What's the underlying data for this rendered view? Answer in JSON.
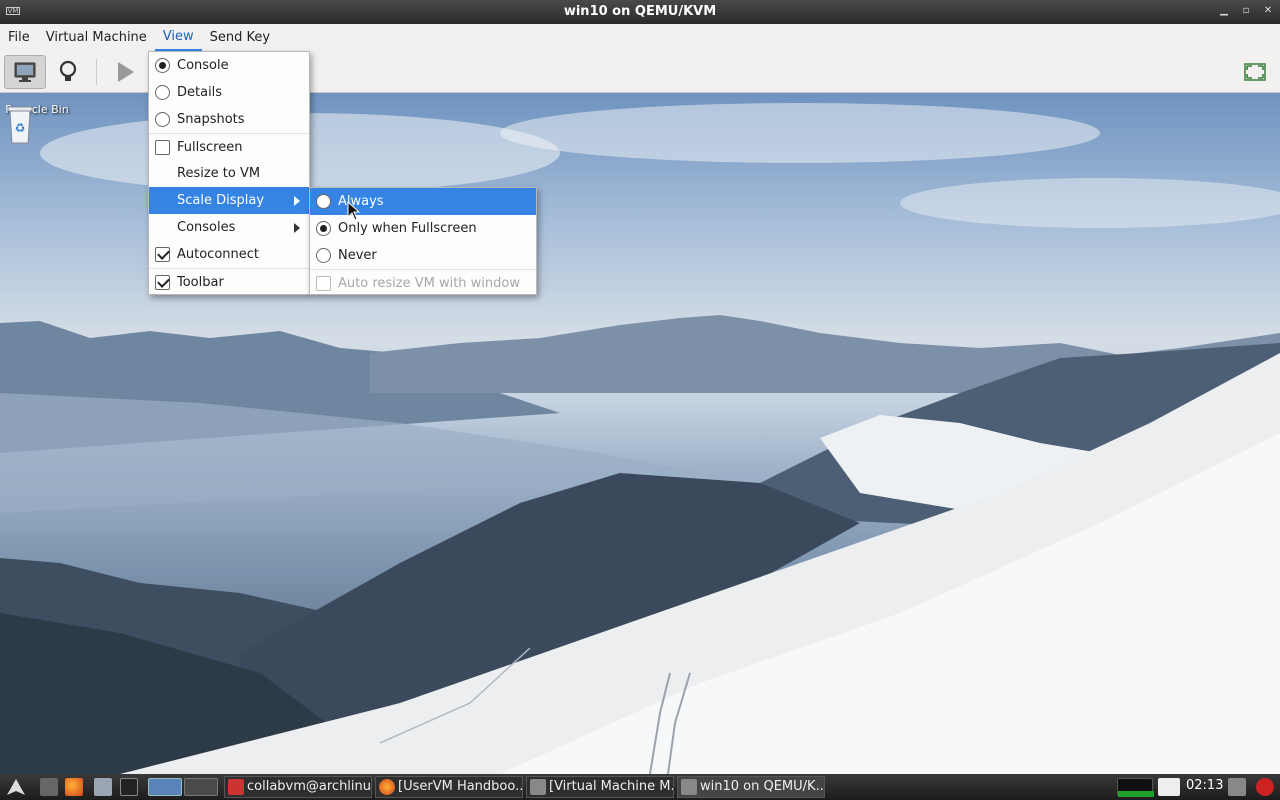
{
  "window": {
    "title": "win10 on QEMU/KVM",
    "app_icon_text": "VM"
  },
  "menubar": {
    "items": [
      "File",
      "Virtual Machine",
      "View",
      "Send Key"
    ],
    "active": "View"
  },
  "desktop": {
    "recycle_bin_label": "Recycle Bin"
  },
  "view_menu": {
    "items": [
      {
        "label": "Console",
        "control": "radio",
        "checked": true
      },
      {
        "label": "Details",
        "control": "radio",
        "checked": false
      },
      {
        "label": "Snapshots",
        "control": "radio",
        "checked": false
      },
      {
        "label": "Fullscreen",
        "control": "check",
        "checked": false
      },
      {
        "label": "Resize to VM",
        "control": "none"
      },
      {
        "label": "Scale Display",
        "control": "submenu",
        "highlighted": true
      },
      {
        "label": "Consoles",
        "control": "submenu"
      },
      {
        "label": "Autoconnect",
        "control": "check",
        "checked": true
      },
      {
        "label": "Toolbar",
        "control": "check",
        "checked": true
      }
    ]
  },
  "scale_submenu": {
    "items": [
      {
        "label": "Always",
        "control": "radio",
        "checked": false,
        "highlighted": true
      },
      {
        "label": "Only when Fullscreen",
        "control": "radio",
        "checked": true
      },
      {
        "label": "Never",
        "control": "radio",
        "checked": false
      },
      {
        "label": "Auto resize VM with window",
        "control": "check",
        "checked": false,
        "disabled": true
      }
    ]
  },
  "taskbar": {
    "tasks": [
      {
        "label": "collabvm@archlinu...",
        "icon": "terminal-icon"
      },
      {
        "label": "[UserVM Handboo...",
        "icon": "firefox-icon"
      },
      {
        "label": "[Virtual Machine M...",
        "icon": "virt-manager-icon"
      },
      {
        "label": "win10 on QEMU/K...",
        "icon": "virt-manager-icon"
      }
    ],
    "clock": "02:13"
  },
  "colors": {
    "menu_highlight": "#3584e4",
    "menubar_bg": "#f2f1f0",
    "titlebar_bg": "#2a2a2a"
  }
}
